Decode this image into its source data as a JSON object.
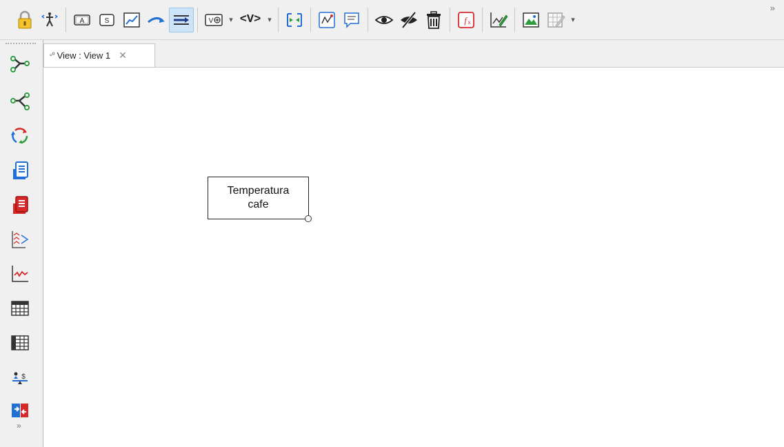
{
  "window": {
    "tab_icon": "view-icon",
    "tab_label": "View : View 1",
    "tab_close": "✕"
  },
  "toolbar": {
    "items": [
      {
        "name": "lock",
        "icon": "lock-icon"
      },
      {
        "name": "move",
        "icon": "move-icon"
      },
      {
        "name": "auxiliary",
        "label": "A"
      },
      {
        "name": "stock",
        "label": "S"
      },
      {
        "name": "graph",
        "icon": "graph-icon"
      },
      {
        "name": "flow",
        "icon": "flow-arrow-icon"
      },
      {
        "name": "connector",
        "icon": "connector-icon",
        "active": true
      },
      {
        "name": "view-options",
        "label": "V"
      },
      {
        "name": "view-variables",
        "label": "<V>"
      },
      {
        "name": "fit",
        "icon": "fit-icon"
      },
      {
        "name": "chart",
        "icon": "chart-icon"
      },
      {
        "name": "comment",
        "icon": "comment-icon"
      },
      {
        "name": "show",
        "icon": "eye-icon"
      },
      {
        "name": "hide",
        "icon": "eye-slash-icon"
      },
      {
        "name": "delete",
        "icon": "trash-icon"
      },
      {
        "name": "function",
        "label": "fx"
      },
      {
        "name": "edit-graph",
        "icon": "edit-graph-icon"
      },
      {
        "name": "image",
        "icon": "image-icon"
      },
      {
        "name": "edit-table",
        "icon": "edit-table-icon"
      }
    ],
    "overflow": "»"
  },
  "left_toolbar": {
    "items": [
      {
        "name": "causes-tree",
        "icon": "causes-tree-icon"
      },
      {
        "name": "uses-tree",
        "icon": "uses-tree-icon"
      },
      {
        "name": "loops",
        "icon": "loops-icon"
      },
      {
        "name": "document",
        "icon": "document-icon"
      },
      {
        "name": "document-red",
        "icon": "document-red-icon"
      },
      {
        "name": "causes-strip",
        "icon": "causes-strip-icon"
      },
      {
        "name": "graph",
        "icon": "line-graph-icon"
      },
      {
        "name": "table",
        "icon": "table-icon"
      },
      {
        "name": "table-time",
        "icon": "table-time-icon"
      },
      {
        "name": "balance",
        "icon": "balance-icon"
      },
      {
        "name": "compare",
        "icon": "compare-icon"
      }
    ],
    "overflow": "»"
  },
  "canvas": {
    "nodes": [
      {
        "label_line1": "Temperatura",
        "label_line2": "cafe"
      }
    ]
  },
  "colors": {
    "accent_blue": "#1f6fd6",
    "accent_green": "#2e9b3f",
    "accent_red": "#d62a2a",
    "active_bg": "#cde3f7"
  }
}
